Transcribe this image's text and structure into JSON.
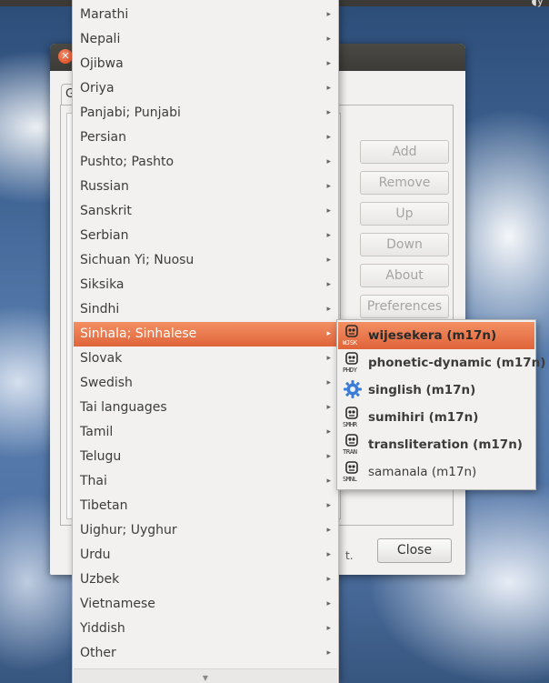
{
  "dialog": {
    "tab_label": "G",
    "buttons": {
      "add": "Add",
      "remove": "Remove",
      "up": "Up",
      "down": "Down",
      "about": "About",
      "preferences": "Preferences"
    },
    "close_label": "Close",
    "note_fragment": "t."
  },
  "menu": {
    "items": [
      {
        "label": "Marathi"
      },
      {
        "label": "Nepali"
      },
      {
        "label": "Ojibwa"
      },
      {
        "label": "Oriya"
      },
      {
        "label": "Panjabi; Punjabi"
      },
      {
        "label": "Persian"
      },
      {
        "label": "Pushto; Pashto"
      },
      {
        "label": "Russian"
      },
      {
        "label": "Sanskrit"
      },
      {
        "label": "Serbian"
      },
      {
        "label": "Sichuan Yi; Nuosu"
      },
      {
        "label": "Siksika"
      },
      {
        "label": "Sindhi"
      },
      {
        "label": "Sinhala; Sinhalese"
      },
      {
        "label": "Slovak"
      },
      {
        "label": "Swedish"
      },
      {
        "label": "Tai languages"
      },
      {
        "label": "Tamil"
      },
      {
        "label": "Telugu"
      },
      {
        "label": "Thai"
      },
      {
        "label": "Tibetan"
      },
      {
        "label": "Uighur; Uyghur"
      },
      {
        "label": "Urdu"
      },
      {
        "label": "Uzbek"
      },
      {
        "label": "Vietnamese"
      },
      {
        "label": "Yiddish"
      },
      {
        "label": "Other"
      }
    ],
    "active_index": 13,
    "submenu_arrow": "▸",
    "scroll_down_arrow": "▼"
  },
  "submenu": {
    "items": [
      {
        "label": "wijesekera (m17n)",
        "icon": "keyboard-robot-icon",
        "tag": "WJSK"
      },
      {
        "label": "phonetic-dynamic (m17n)",
        "icon": "keyboard-robot-icon",
        "tag": "PHDY"
      },
      {
        "label": "singlish (m17n)",
        "icon": "gear-icon",
        "tag": ""
      },
      {
        "label": "sumihiri (m17n)",
        "icon": "keyboard-robot-icon",
        "tag": "SMHR"
      },
      {
        "label": "transliteration (m17n)",
        "icon": "keyboard-robot-icon",
        "tag": "TRAN"
      },
      {
        "label": "samanala (m17n)",
        "icon": "keyboard-robot-icon",
        "tag": "SMNL"
      }
    ]
  },
  "colors": {
    "highlight": "#e9774a",
    "menu_bg": "#f2f1f0",
    "gear_blue": "#3a7bd5"
  }
}
